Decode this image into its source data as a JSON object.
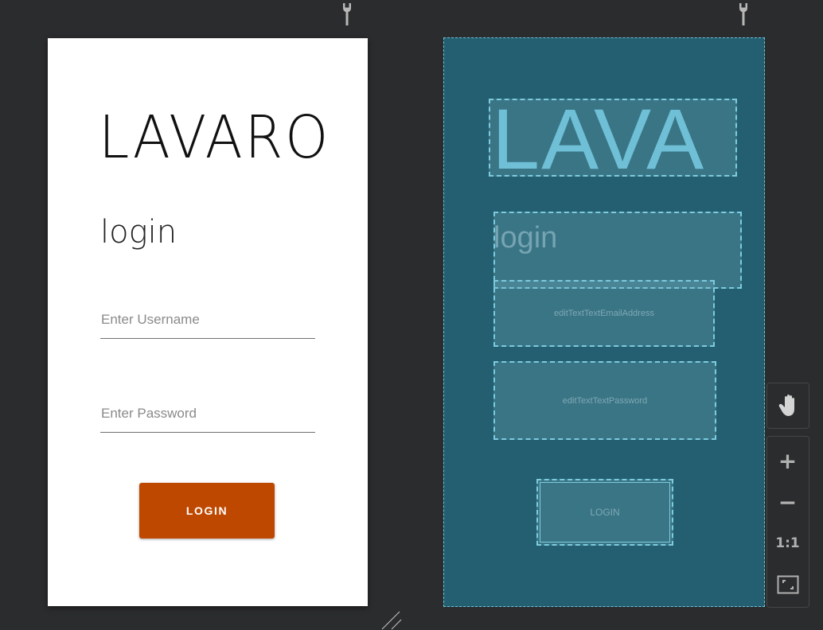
{
  "design_preview": {
    "app_title": "LAVARO",
    "subtitle": "login",
    "username_placeholder": "Enter Username",
    "password_placeholder": "Enter Password",
    "login_button": "LOGIN",
    "button_color": "#bf4800"
  },
  "blueprint": {
    "title_text": "LAVA",
    "subtitle_text": "login",
    "username_id": "editTextTextEmailAddress",
    "password_id": "editTextTextPassword",
    "button_text": "LOGIN",
    "background_color": "#235f70"
  },
  "zoom_toolbar": {
    "pan_icon": "hand-icon",
    "zoom_in_label": "+",
    "zoom_out_label": "−",
    "actual_size_label": "1:1",
    "fit_icon": "fit-screen-icon"
  },
  "icons": {
    "wrench_left": "wrench-icon",
    "wrench_right": "wrench-icon"
  }
}
